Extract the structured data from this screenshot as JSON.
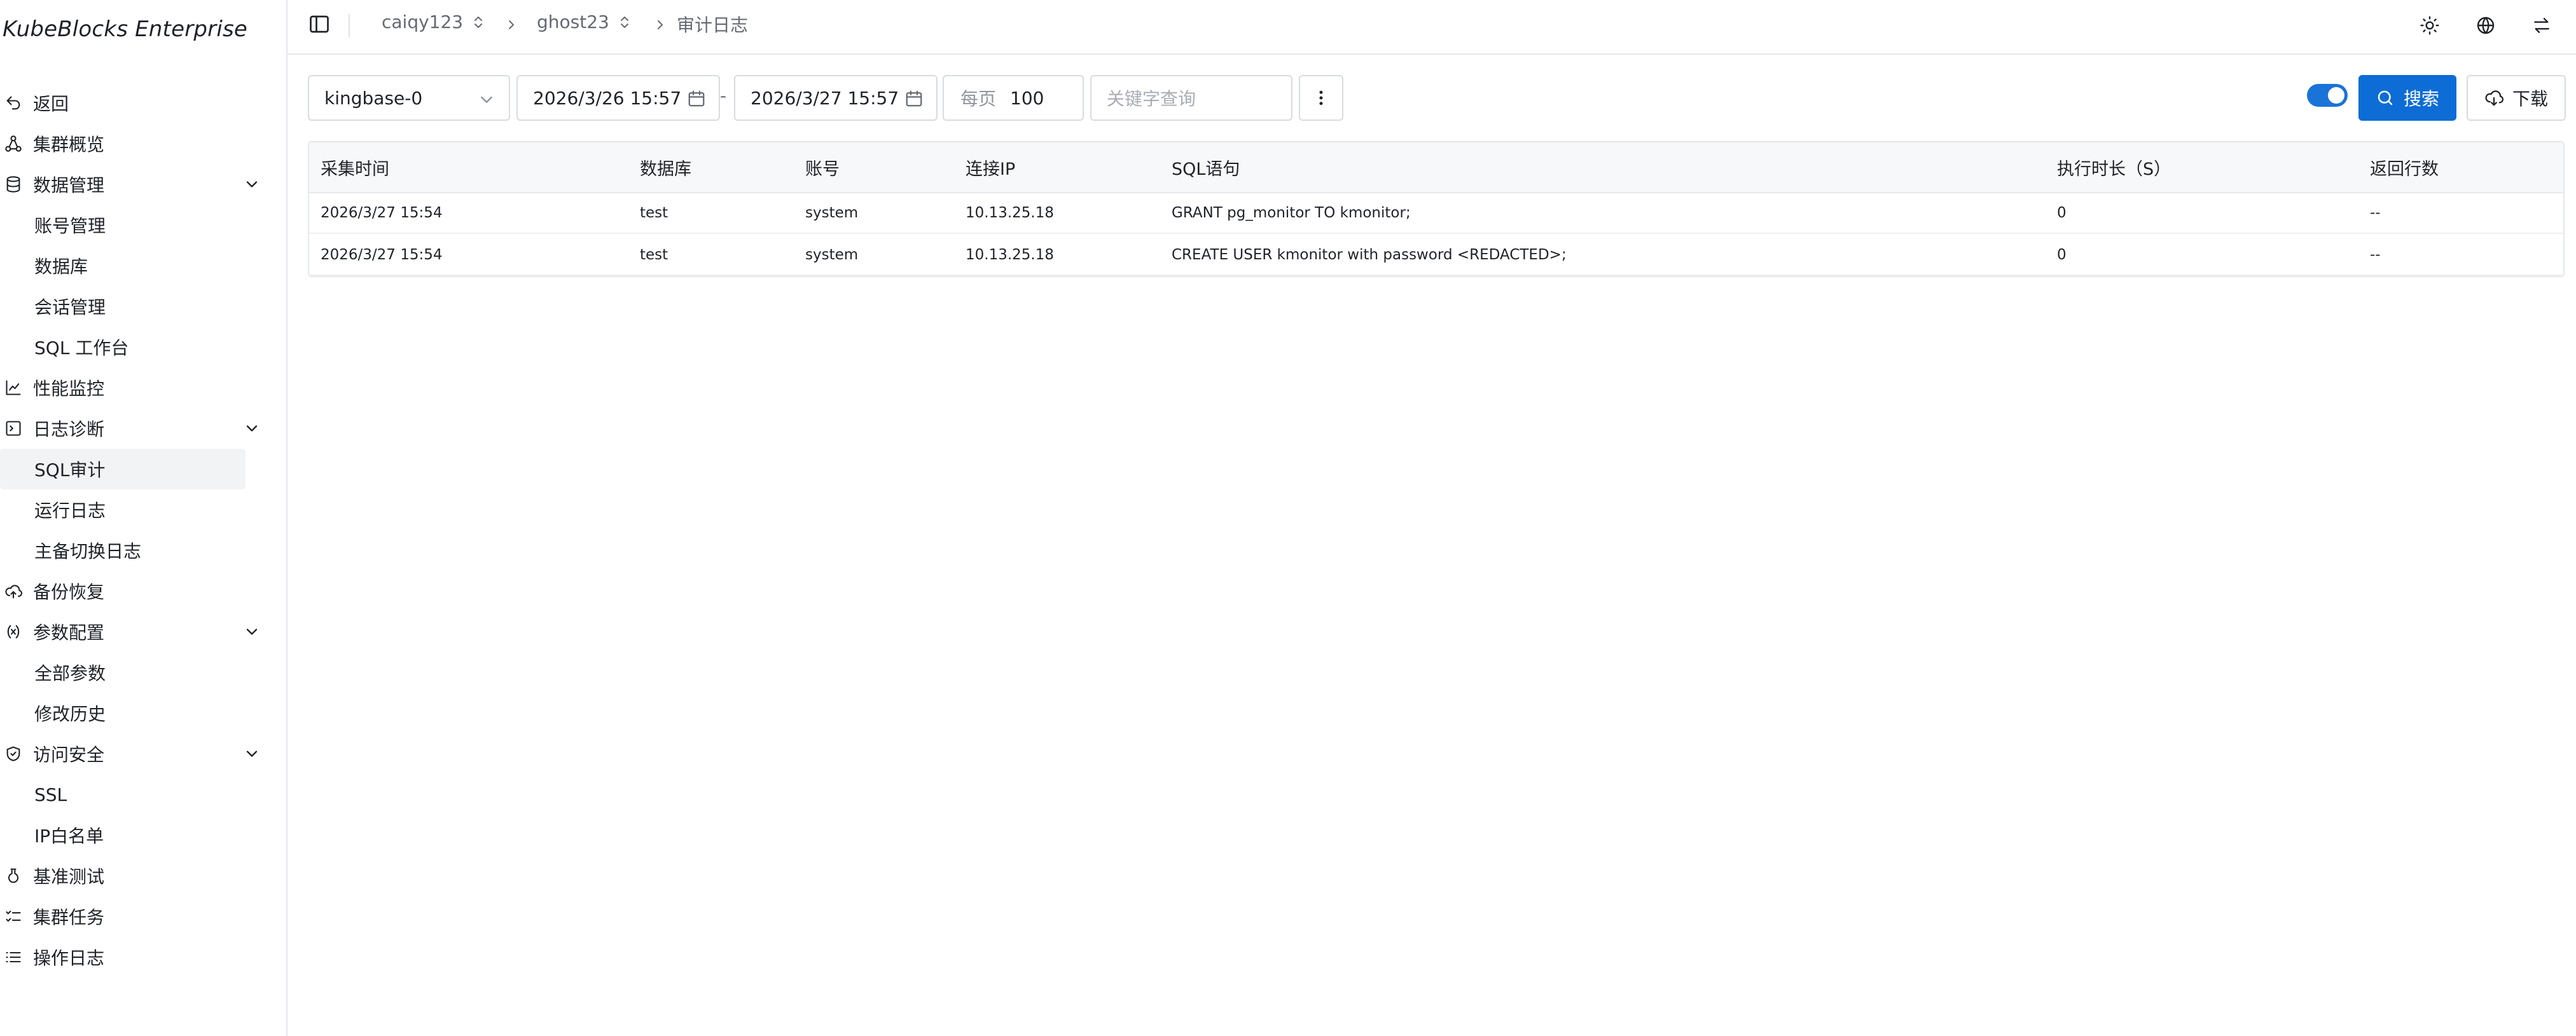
{
  "brand": {
    "name": "KubeBlocks Enterprise"
  },
  "sidebar": {
    "items": [
      {
        "label": "返回",
        "icon": "undo-icon"
      },
      {
        "label": "集群概览",
        "icon": "cluster-topology-icon"
      },
      {
        "label": "数据管理",
        "icon": "database-icon",
        "expanded": true,
        "children": [
          "账号管理",
          "数据库",
          "会话管理",
          "SQL 工作台"
        ]
      },
      {
        "label": "性能监控",
        "icon": "line-chart-icon"
      },
      {
        "label": "日志诊断",
        "icon": "terminal-icon",
        "expanded": true,
        "children": [
          "SQL审计",
          "运行日志",
          "主备切换日志"
        ],
        "active_child": "SQL审计"
      },
      {
        "label": "备份恢复",
        "icon": "cloud-upload-icon"
      },
      {
        "label": "参数配置",
        "icon": "variable-icon",
        "expanded": true,
        "children": [
          "全部参数",
          "修改历史"
        ]
      },
      {
        "label": "访问安全",
        "icon": "shield-check-icon",
        "expanded": true,
        "children": [
          "SSL",
          "IP白名单"
        ]
      },
      {
        "label": "基准测试",
        "icon": "flask-icon"
      },
      {
        "label": "集群任务",
        "icon": "task-list-icon"
      },
      {
        "label": "操作日志",
        "icon": "list-icon"
      }
    ]
  },
  "topbar": {
    "breadcrumb": [
      "caiqy123",
      "ghost23",
      "审计日志"
    ],
    "icons": [
      "theme-sun-icon",
      "language-globe-icon",
      "switch-arrows-icon"
    ]
  },
  "toolbar": {
    "instance_select": "kingbase-0",
    "start_time": "2026/3/26 15:57",
    "range_separator": "-",
    "end_time": "2026/3/27 15:57",
    "page_size_label": "每页",
    "page_size_value": "100",
    "keyword_placeholder": "关键字查询",
    "toggle_on": true,
    "search_label": "搜索",
    "download_label": "下载",
    "accent_color": "#0d6cd6"
  },
  "table": {
    "columns": [
      "采集时间",
      "数据库",
      "账号",
      "连接IP",
      "SQL语句",
      "执行时长（S）",
      "返回行数"
    ],
    "rows": [
      [
        "2026/3/27 15:54",
        "test",
        "system",
        "10.13.25.18",
        "GRANT pg_monitor TO kmonitor;",
        "0",
        "--"
      ],
      [
        "2026/3/27 15:54",
        "test",
        "system",
        "10.13.25.18",
        "CREATE USER kmonitor with password <REDACTED>;",
        "0",
        "--"
      ]
    ]
  }
}
